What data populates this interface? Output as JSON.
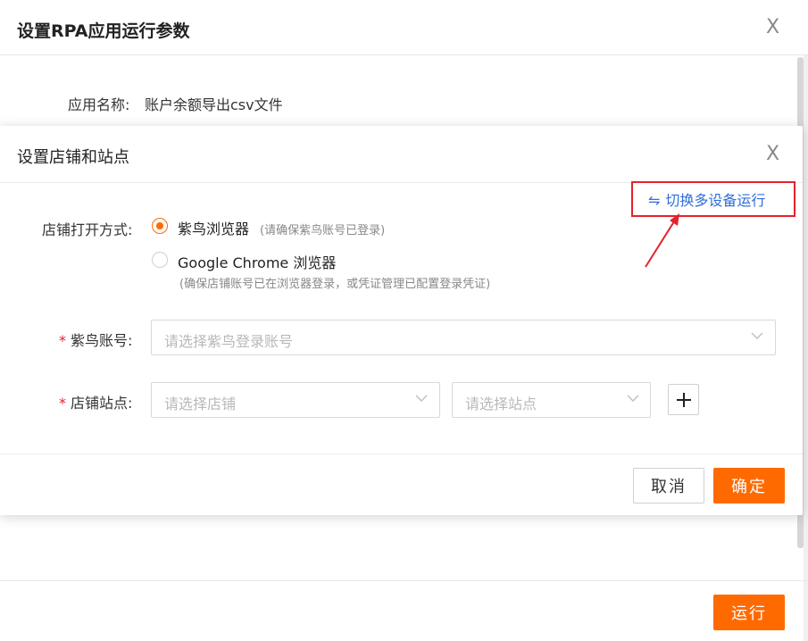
{
  "background_dialog": {
    "title": "设置RPA应用运行参数",
    "close_symbol": "X",
    "app_name_label": "应用名称:",
    "app_name_value": "账户余额导出csv文件",
    "run_button": "运行"
  },
  "modal": {
    "title": "设置店铺和站点",
    "close_symbol": "X",
    "switch_link": {
      "icon": "swap-arrows-icon",
      "icon_glyph": "⇋",
      "label": "切换多设备运行"
    },
    "open_method": {
      "label": "店铺打开方式:",
      "options": [
        {
          "label": "紫鸟浏览器",
          "hint": "(请确保紫鸟账号已登录)",
          "selected": true
        },
        {
          "label": "Google Chrome 浏览器",
          "hint": "(确保店铺账号已在浏览器登录，或凭证管理已配置登录凭证)",
          "selected": false
        }
      ]
    },
    "account_field": {
      "required_mark": "*",
      "label": "紫鸟账号:",
      "placeholder": "请选择紫鸟登录账号"
    },
    "shop_site_field": {
      "required_mark": "*",
      "label": "店铺站点:",
      "shop_placeholder": "请选择店铺",
      "site_placeholder": "请选择站点"
    },
    "buttons": {
      "cancel": "取消",
      "ok": "确定"
    }
  },
  "colors": {
    "accent": "#ff6a00",
    "link": "#2f6fd8",
    "highlight_box": "#e5212a",
    "required": "#e5212a"
  }
}
